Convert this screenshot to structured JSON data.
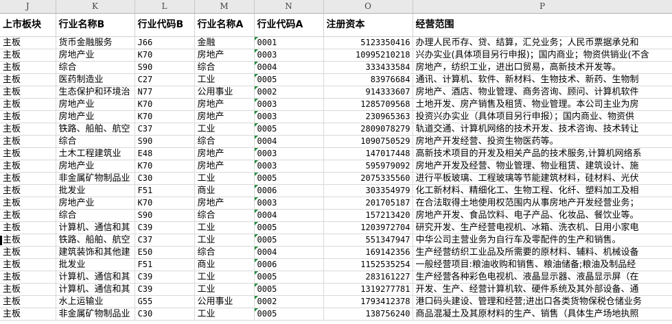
{
  "columns": [
    "J",
    "K",
    "L",
    "M",
    "N",
    "O",
    "P"
  ],
  "headers": [
    "上市板块",
    "行业名称B",
    "行业代码B",
    "行业名称A",
    "行业代码A",
    "注册资本",
    "经营范围"
  ],
  "rows": [
    [
      "主板",
      "货币金融服务",
      "J66",
      "金融",
      "0001",
      "5123350416",
      "办理人民币存、贷、结算，汇兑业务；人民币票据承兑和"
    ],
    [
      "主板",
      "房地产业",
      "K70",
      "房地产",
      "0003",
      "10995210218",
      "兴办实业(具体项目另行申报)；国内商业；物资供销业(不含"
    ],
    [
      "主板",
      "综合",
      "S90",
      "综合",
      "0004",
      "333433584",
      "房地产，纺织工业，进出口贸易，高新技术开发等。"
    ],
    [
      "主板",
      "医药制造业",
      "C27",
      "工业",
      "0005",
      "83976684",
      "通讯、计算机、软件、新材料、生物技术、新药、生物制"
    ],
    [
      "主板",
      "生态保护和环境治",
      "N77",
      "公用事业",
      "0002",
      "914333607",
      "房地产、酒店、物业管理、商务咨询、顾问、计算机软件"
    ],
    [
      "主板",
      "房地产业",
      "K70",
      "房地产",
      "0003",
      "1285709568",
      "土地开发、房产销售及租赁、物业管理。本公司主业为房"
    ],
    [
      "主板",
      "房地产业",
      "K70",
      "房地产",
      "0003",
      "230965363",
      "投资兴办实业（具体项目另行申报）；国内商业、物资供"
    ],
    [
      "主板",
      "铁路、船舶、航空",
      "C37",
      "工业",
      "0005",
      "2809078279",
      "轨道交通、计算机网络的技术开发、技术咨询、技术转让"
    ],
    [
      "主板",
      "综合",
      "S90",
      "综合",
      "0004",
      "1090750529",
      "房地产开发经营、投资生物医药等。"
    ],
    [
      "主板",
      "土木工程建筑业",
      "E48",
      "房地产",
      "0003",
      "147017448",
      "高新技术项目的开发及相关产品的技术服务,计算机网络系"
    ],
    [
      "主板",
      "房地产业",
      "K70",
      "房地产",
      "0003",
      "595979092",
      "房地产开发及经营、物业管理、物业租赁、建筑设计、施"
    ],
    [
      "主板",
      "非金属矿物制品业",
      "C30",
      "工业",
      "0005",
      "2075335560",
      "进行平板玻璃、工程玻璃等节能建筑材料，硅材料、光伏"
    ],
    [
      "主板",
      "批发业",
      "F51",
      "商业",
      "0006",
      "303354979",
      "化工新材料、精细化工、生物工程、化纤、塑料加工及相"
    ],
    [
      "主板",
      "房地产业",
      "K70",
      "房地产",
      "0003",
      "201705187",
      "在合法取得土地使用权范围内从事房地产开发经营业务；"
    ],
    [
      "主板",
      "综合",
      "S90",
      "综合",
      "0004",
      "157213420",
      "房地产开发、食品饮料、电子产品、化妆品、餐饮业等。"
    ],
    [
      "主板",
      "计算机、通信和其",
      "C39",
      "工业",
      "0005",
      "1203972704",
      "研究开发、生产经营电视机、冰箱、洗衣机、日用小家电"
    ],
    [
      "主板",
      "铁路、船舶、航空",
      "C37",
      "工业",
      "0005",
      "551347947",
      "中华公司主营业务为自行车及零配件的生产和销售。"
    ],
    [
      "主板",
      "建筑装饰和其他建",
      "E50",
      "综合",
      "0004",
      "169142356",
      "生产经营纺织工业品及所需要的原材料、辅料、机械设备"
    ],
    [
      "主板",
      "批发业",
      "F51",
      "商业",
      "0006",
      "1152535254",
      "一般经营项目:粮油收购和销售、粮油储备;粮油及制品经"
    ],
    [
      "主板",
      "计算机、通信和其",
      "C39",
      "工业",
      "0005",
      "283161227",
      "生产经营各种彩色电视机、液晶显示器、液晶显示屏（在"
    ],
    [
      "主板",
      "计算机、通信和其",
      "C39",
      "工业",
      "0005",
      "1319277781",
      "开发、生产、经营计算机软、硬件系统及其外部设备、通"
    ],
    [
      "主板",
      "水上运输业",
      "G55",
      "公用事业",
      "0002",
      "1793412378",
      "港口码头建设、管理和经营;进出口各类货物保税仓储业务"
    ],
    [
      "主板",
      "非金属矿物制品业",
      "C30",
      "工业",
      "0005",
      "138756240",
      "商品混凝土及其原材料的生产、销售（具体生产场地执照"
    ]
  ]
}
